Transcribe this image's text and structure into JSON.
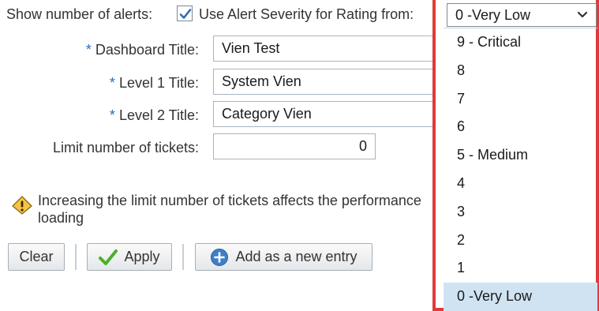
{
  "header": {
    "show_alerts_label": "Show number of alerts:",
    "use_severity_checked": true,
    "use_severity_label": "Use Alert Severity for Rating from:"
  },
  "form": {
    "required_marker": "*",
    "dashboard_title": {
      "label": "Dashboard Title:",
      "value": "Vien Test"
    },
    "level1_title": {
      "label": "Level 1 Title:",
      "value": "System Vien"
    },
    "level2_title": {
      "label": "Level 2 Title:",
      "value": "Category Vien"
    },
    "limit_tickets": {
      "label": "Limit number of tickets:",
      "value": "0"
    }
  },
  "warning": {
    "icon": "warning-icon",
    "text": "Increasing the limit number of tickets affects the performance loading"
  },
  "buttons": {
    "clear": "Clear",
    "apply": "Apply",
    "add_entry": "Add as a new entry"
  },
  "severity_select": {
    "selected": "0 -Very Low",
    "options": [
      "9 - Critical",
      "8",
      "7",
      "6",
      "5 - Medium",
      "4",
      "3",
      "2",
      "1",
      "0 -Very Low"
    ]
  },
  "colors": {
    "highlight_border": "#e03a3a",
    "selected_option_bg": "#cfe3f3",
    "apply_check": "#4caf2a",
    "add_icon": "#3f7fc7",
    "warning_fill": "#f6c343"
  }
}
